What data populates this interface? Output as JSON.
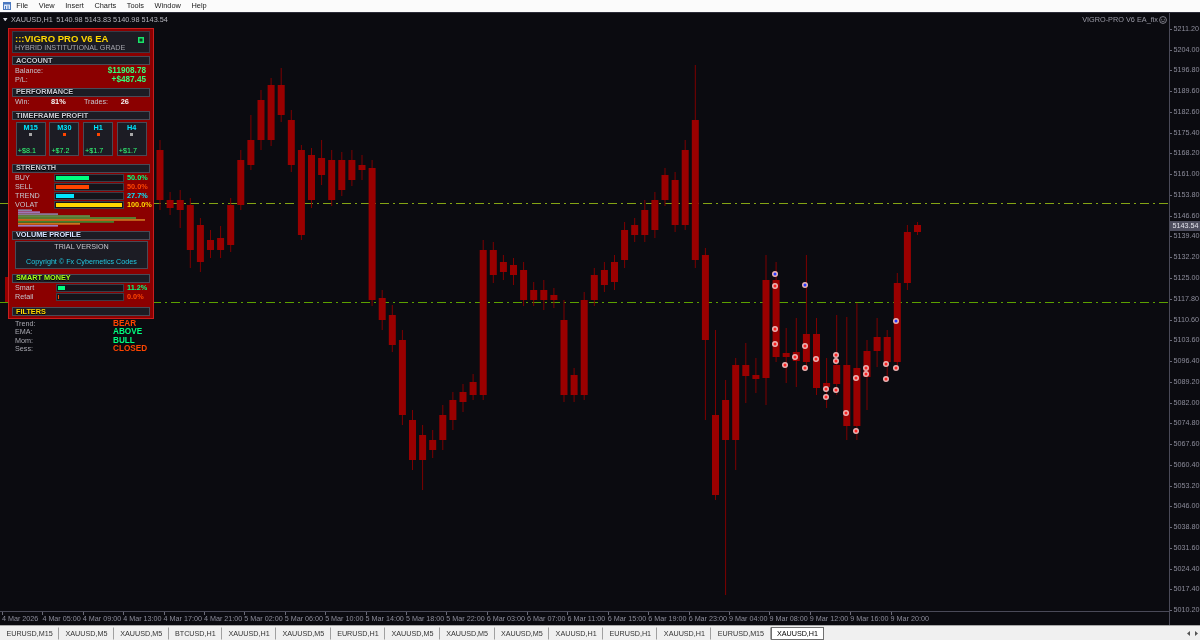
{
  "menu": [
    "File",
    "View",
    "Insert",
    "Charts",
    "Tools",
    "Window",
    "Help"
  ],
  "chart": {
    "symbol": "XAUUSD,H1",
    "ohlc": "5140.98 5143.83 5140.98 5143.54",
    "expert": "VIGRO-PRO V6 EA_fix",
    "price_axis": [
      {
        "label": "5211.20",
        "kind": "tick"
      },
      {
        "label": "5204.00",
        "kind": "tick"
      },
      {
        "label": "5196.80",
        "kind": "tick"
      },
      {
        "label": "5189.60",
        "kind": "tick"
      },
      {
        "label": "5182.60",
        "kind": "tick"
      },
      {
        "label": "5175.40",
        "kind": "tick"
      },
      {
        "label": "5168.20",
        "kind": "tick"
      },
      {
        "label": "5161.00",
        "kind": "tick"
      },
      {
        "label": "5153.80",
        "kind": "tick"
      },
      {
        "label": "5146.60",
        "kind": "tick"
      },
      {
        "label": "5143.54",
        "kind": "current"
      },
      {
        "label": "5139.40",
        "kind": "tick"
      },
      {
        "label": "5132.20",
        "kind": "tick"
      },
      {
        "label": "5125.00",
        "kind": "tick"
      },
      {
        "label": "5117.80",
        "kind": "tick"
      },
      {
        "label": "5110.60",
        "kind": "tick"
      },
      {
        "label": "5103.60",
        "kind": "tick"
      },
      {
        "label": "5096.40",
        "kind": "tick"
      },
      {
        "label": "5089.20",
        "kind": "tick"
      },
      {
        "label": "5082.00",
        "kind": "tick"
      },
      {
        "label": "5074.80",
        "kind": "tick"
      },
      {
        "label": "5067.60",
        "kind": "tick"
      },
      {
        "label": "5060.40",
        "kind": "tick"
      },
      {
        "label": "5053.20",
        "kind": "tick"
      },
      {
        "label": "5046.00",
        "kind": "tick"
      },
      {
        "label": "5038.80",
        "kind": "tick"
      },
      {
        "label": "5031.60",
        "kind": "tick"
      },
      {
        "label": "5024.40",
        "kind": "tick"
      },
      {
        "label": "5017.40",
        "kind": "tick"
      },
      {
        "label": "5010.20",
        "kind": "tick"
      }
    ],
    "time_axis": [
      "4 Mar 2026",
      "4 Mar 05:00",
      "4 Mar 09:00",
      "4 Mar 13:00",
      "4 Mar 17:00",
      "4 Mar 21:00",
      "5 Mar 02:00",
      "5 Mar 06:00",
      "5 Mar 10:00",
      "5 Mar 14:00",
      "5 Mar 18:00",
      "5 Mar 22:00",
      "6 Mar 03:00",
      "6 Mar 07:00",
      "6 Mar 11:00",
      "6 Mar 15:00",
      "6 Mar 19:00",
      "6 Mar 23:00",
      "9 Mar 04:00",
      "9 Mar 08:00",
      "9 Mar 12:00",
      "9 Mar 16:00",
      "9 Mar 20:00"
    ]
  },
  "ea_panel": {
    "title": ":::VIGRO PRO V6 EA",
    "subtitle": "HYBRID INSTITUTIONAL GRADE",
    "account": {
      "heading": "ACCOUNT",
      "rows": [
        {
          "label": "Balance:",
          "value": "$11908.78"
        },
        {
          "label": "P/L:",
          "value": "+$487.45"
        }
      ]
    },
    "performance": {
      "heading": "PERFORMANCE",
      "stats": [
        {
          "label": "Win:",
          "value": "81%"
        },
        {
          "label": "Trades:",
          "value": "26"
        }
      ]
    },
    "timeframe_profit": {
      "heading": "TIMEFRAME PROFIT",
      "frames": [
        {
          "label": "M15",
          "color": "#a8a8a8",
          "profit": "+$8.1"
        },
        {
          "label": "M30",
          "color": "#ff4500",
          "profit": "+$7.2"
        },
        {
          "label": "H1",
          "color": "#ff4500",
          "profit": "+$1.7"
        },
        {
          "label": "H4",
          "color": "#a8a8a8",
          "profit": "+$1.7"
        }
      ]
    },
    "strength": {
      "heading": "STRENGTH",
      "bars": [
        {
          "label": "BUY",
          "level": 0.5,
          "reading": "50.0%",
          "color": "#00ff7f"
        },
        {
          "label": "SELL",
          "level": 0.5,
          "reading": "50.0%",
          "color": "#ff4500"
        },
        {
          "label": "TREND",
          "level": 0.277,
          "reading": "27.7%",
          "color": "#00e5ff"
        },
        {
          "label": "VOLAT",
          "level": 1,
          "reading": "100.0%",
          "color": "#ffd700"
        }
      ]
    },
    "volume_profile": {
      "heading": "VOLUME PROFILE",
      "notice": "TRIAL VERSION",
      "copyright": "Copyright © Fx Cybernetics Codes"
    },
    "smart_money": {
      "heading": "SMART MONEY",
      "bars": [
        {
          "label": "Smart",
          "level": 0.112,
          "reading": "11.2%",
          "color": "#00ff7f"
        },
        {
          "label": "Retail",
          "level": 0,
          "reading": "0.0%",
          "color": "#ff4500"
        }
      ]
    },
    "filters": {
      "heading": "FILTERS",
      "rows": [
        {
          "label": "Trend:",
          "value": "BEAR",
          "color": "#ff4500"
        },
        {
          "label": "EMA:",
          "value": "ABOVE",
          "color": "#00ff7f"
        },
        {
          "label": "Mom:",
          "value": "BULL",
          "color": "#00ff7f"
        },
        {
          "label": "Sess:",
          "value": "CLOSED",
          "color": "#ff4500"
        }
      ]
    }
  },
  "tabs": [
    {
      "label": "EURUSD,M15",
      "selected": false
    },
    {
      "label": "XAUUSD,M5",
      "selected": false
    },
    {
      "label": "XAUUSD,M5",
      "selected": false
    },
    {
      "label": "BTCUSD,H1",
      "selected": false
    },
    {
      "label": "XAUUSD,H1",
      "selected": false
    },
    {
      "label": "XAUUSD,M5",
      "selected": false
    },
    {
      "label": "EURUSD,H1",
      "selected": false
    },
    {
      "label": "XAUUSD,M5",
      "selected": false
    },
    {
      "label": "XAUUSD,M5",
      "selected": false
    },
    {
      "label": "XAUUSD,M5",
      "selected": false
    },
    {
      "label": "XAUUSD,H1",
      "selected": false
    },
    {
      "label": "EURUSD,H1",
      "selected": false
    },
    {
      "label": "XAUUSD,H1",
      "selected": false
    },
    {
      "label": "EURUSD,M15",
      "selected": false
    },
    {
      "label": "XAUUSD,H1",
      "selected": true
    }
  ]
}
